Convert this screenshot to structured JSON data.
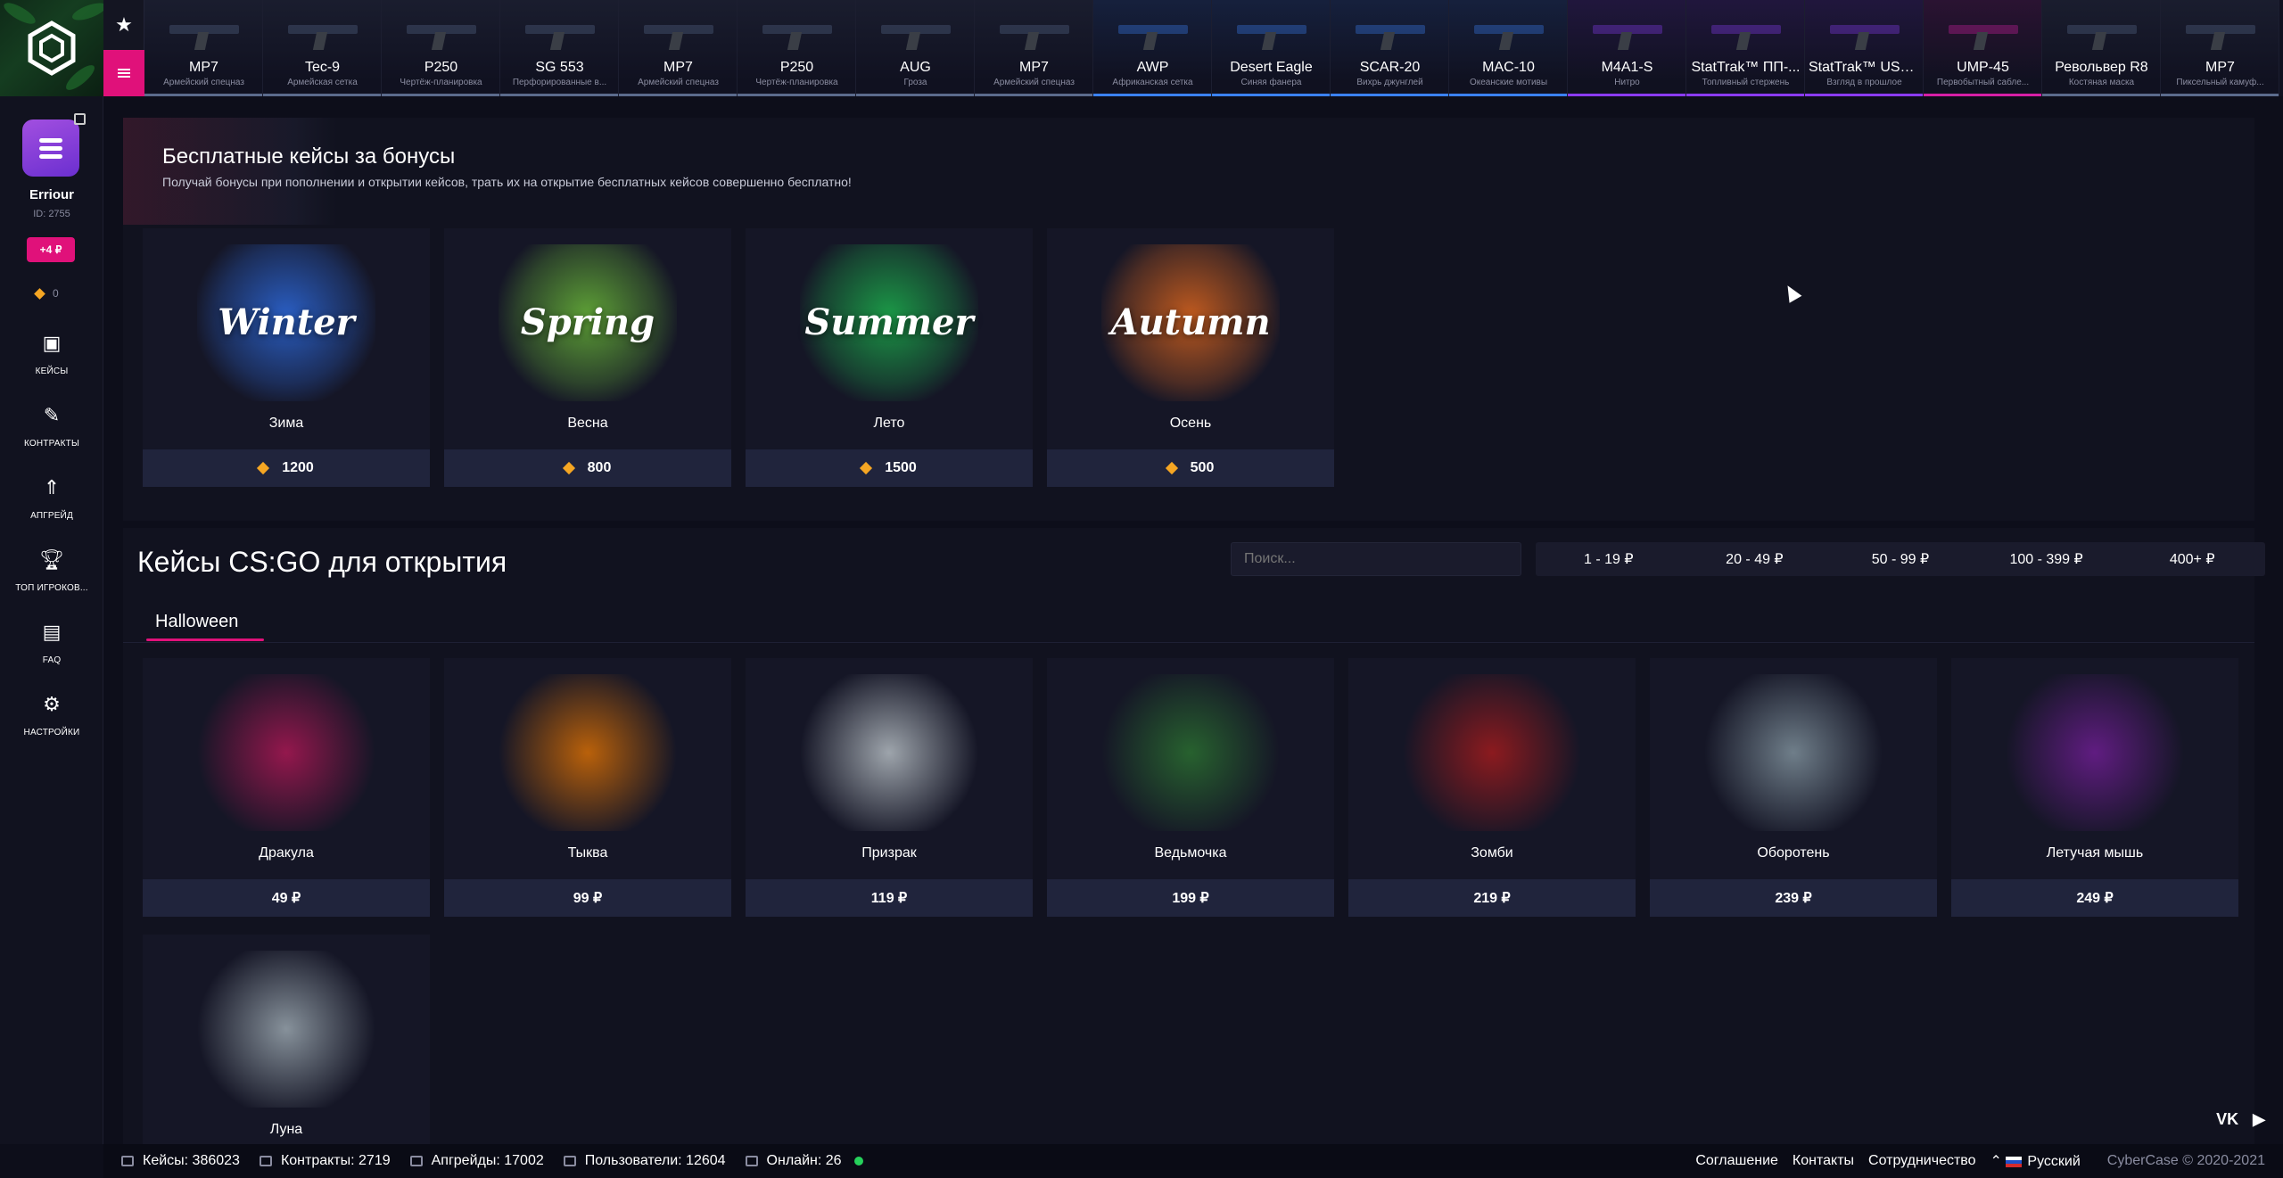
{
  "site": {
    "name": "CyberCase",
    "copyright": "CyberCase © 2020-2021"
  },
  "user": {
    "name": "Erriour",
    "id": "ID: 2755",
    "balance": "+4 ₽",
    "bonus": "0"
  },
  "nav": [
    {
      "label": "КЕЙСЫ",
      "icon": "box-icon"
    },
    {
      "label": "КОНТРАКТЫ",
      "icon": "contract-icon"
    },
    {
      "label": "АПГРЕЙД",
      "icon": "upgrade-icon"
    },
    {
      "label": "ТОП ИГРОКОВ...",
      "icon": "trophy-icon"
    },
    {
      "label": "FAQ",
      "icon": "chat-icon"
    },
    {
      "label": "НАСТРОЙКИ",
      "icon": "gear-icon"
    }
  ],
  "ticker": [
    {
      "name": "MP7",
      "skin": "Армейский спецназ",
      "color": "#5b6b8c"
    },
    {
      "name": "Tec-9",
      "skin": "Армейская сетка",
      "color": "#5b6b8c"
    },
    {
      "name": "P250",
      "skin": "Чертёж-планировка",
      "color": "#5b6b8c"
    },
    {
      "name": "SG 553",
      "skin": "Перфорированные в...",
      "color": "#5b6b8c"
    },
    {
      "name": "MP7",
      "skin": "Армейский спецназ",
      "color": "#5b6b8c"
    },
    {
      "name": "P250",
      "skin": "Чертёж-планировка",
      "color": "#5b6b8c"
    },
    {
      "name": "AUG",
      "skin": "Гроза",
      "color": "#5b6b8c"
    },
    {
      "name": "MP7",
      "skin": "Армейский спецназ",
      "color": "#5b6b8c"
    },
    {
      "name": "AWP",
      "skin": "Африканская сетка",
      "color": "#3b82f6"
    },
    {
      "name": "Desert Eagle",
      "skin": "Синяя фанера",
      "color": "#3b82f6"
    },
    {
      "name": "SCAR-20",
      "skin": "Вихрь джунглей",
      "color": "#3b82f6"
    },
    {
      "name": "MAC-10",
      "skin": "Океанские мотивы",
      "color": "#3b82f6"
    },
    {
      "name": "M4A1-S",
      "skin": "Нитро",
      "color": "#8b3bf6"
    },
    {
      "name": "StatTrak™ ПП-...",
      "skin": "Топливный стержень",
      "color": "#8b3bf6"
    },
    {
      "name": "StatTrak™ USP-S",
      "skin": "Взгляд в прошлое",
      "color": "#8b3bf6"
    },
    {
      "name": "UMP-45",
      "skin": "Первобытный сабле...",
      "color": "#d61fa5"
    },
    {
      "name": "Револьвер R8",
      "skin": "Костяная маска",
      "color": "#5b6b8c"
    },
    {
      "name": "MP7",
      "skin": "Пиксельный камуф...",
      "color": "#5b6b8c"
    }
  ],
  "free": {
    "title": "Бесплатные кейсы за бонусы",
    "subtitle": "Получай бонусы при пополнении и открытии кейсов, трать их на открытие бесплатных кейсов совершенно бесплатно!",
    "cases": [
      {
        "name": "Зима",
        "price": "1200",
        "art": "Winter",
        "color": "#2f6fe8"
      },
      {
        "name": "Весна",
        "price": "800",
        "art": "Spring",
        "color": "#6fc23a"
      },
      {
        "name": "Лето",
        "price": "1500",
        "art": "Summer",
        "color": "#1db84f"
      },
      {
        "name": "Осень",
        "price": "500",
        "art": "Autumn",
        "color": "#e86a1d"
      }
    ]
  },
  "csgo": {
    "title": "Кейсы CS:GO для открытия",
    "search_placeholder": "Поиск...",
    "filters": [
      "1 - 19 ₽",
      "20 - 49 ₽",
      "50 - 99 ₽",
      "100 - 399 ₽",
      "400+ ₽"
    ],
    "tab": "Halloween",
    "cases": [
      {
        "name": "Дракула",
        "price": "49 ₽",
        "color": "#c2185b"
      },
      {
        "name": "Тыква",
        "price": "99 ₽",
        "color": "#f57c00"
      },
      {
        "name": "Призрак",
        "price": "119 ₽",
        "color": "#cfd8dc"
      },
      {
        "name": "Ведьмочка",
        "price": "199 ₽",
        "color": "#2e7d32"
      },
      {
        "name": "Зомби",
        "price": "219 ₽",
        "color": "#b71c1c"
      },
      {
        "name": "Оборотень",
        "price": "239 ₽",
        "color": "#90a4ae"
      },
      {
        "name": "Летучая мышь",
        "price": "249 ₽",
        "color": "#7b1fa2"
      },
      {
        "name": "Луна",
        "price": "",
        "color": "#b0bec5"
      }
    ]
  },
  "footer": {
    "stats": [
      {
        "label": "Кейсы: 386023",
        "icon": "box-icon"
      },
      {
        "label": "Контракты: 2719",
        "icon": "contract-icon"
      },
      {
        "label": "Апгрейды: 17002",
        "icon": "upgrade-icon"
      },
      {
        "label": "Пользователи: 12604",
        "icon": "users-icon"
      },
      {
        "label": "Онлайн: 26",
        "icon": "online-icon"
      }
    ],
    "links": [
      "Соглашение",
      "Контакты",
      "Сотрудничество"
    ],
    "language": "Русский",
    "social": [
      "VK",
      "▶"
    ]
  }
}
